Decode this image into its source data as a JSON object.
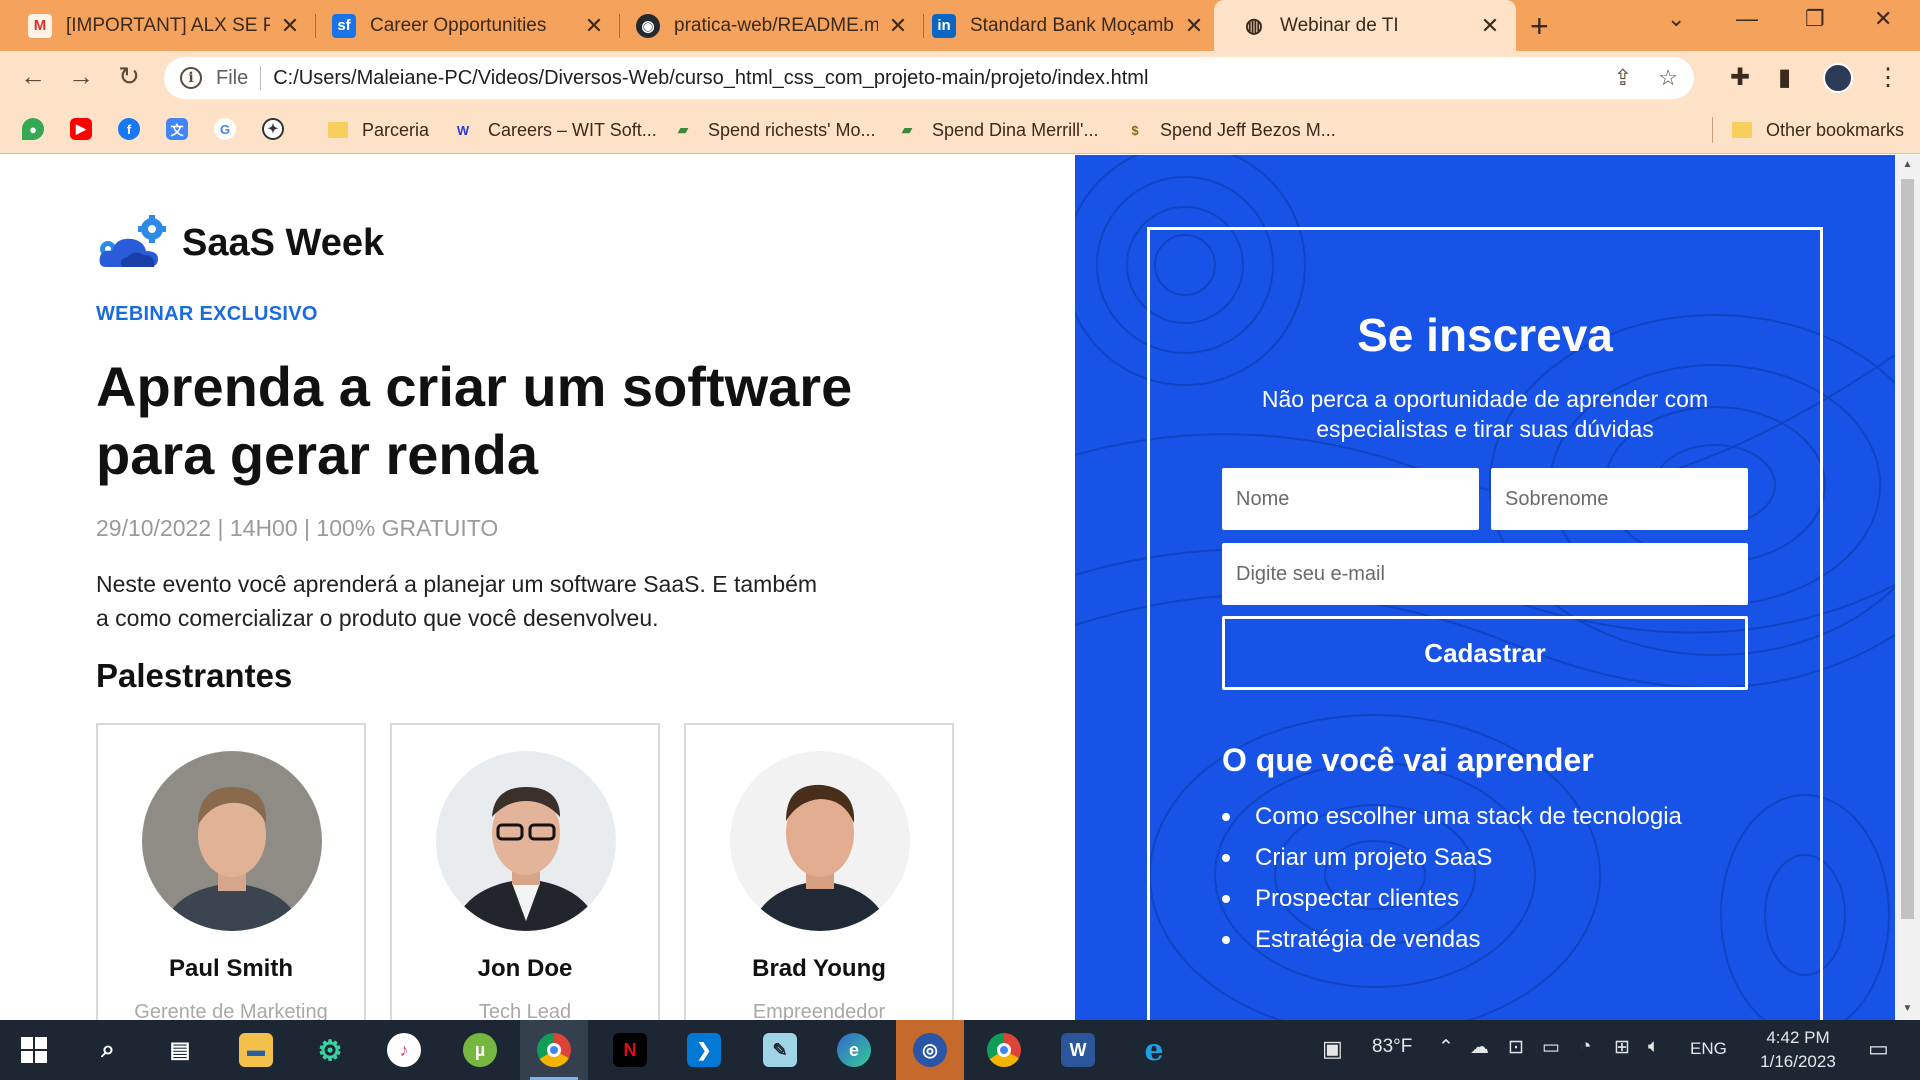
{
  "browser": {
    "tabs": [
      {
        "title": "[IMPORTANT] ALX SE Prog",
        "icon": "gmail-icon"
      },
      {
        "title": "Career Opportunities",
        "icon": "sf-icon"
      },
      {
        "title": "pratica-web/README.md",
        "icon": "github-icon"
      },
      {
        "title": "Standard Bank Moçambiq",
        "icon": "linkedin-icon"
      },
      {
        "title": "Webinar de TI",
        "icon": "globe-icon",
        "active": true
      }
    ],
    "new_tab": "+",
    "window_controls": {
      "tab_search": "⌄",
      "minimize": "—",
      "restore": "❐",
      "close": "✕"
    },
    "address_scheme": "File",
    "address_url": "C:/Users/Maleiane-PC/Videos/Diversos-Web/curso_html_css_com_projeto-main/projeto/index.html"
  },
  "bookmarks": {
    "icon_shortcuts": [
      "maps-icon",
      "youtube-icon",
      "facebook-icon",
      "translate-icon",
      "google-icon",
      "emblem-icon"
    ],
    "items": [
      {
        "label": "Parceria",
        "icon": "folder-icon"
      },
      {
        "label": "Careers – WIT Soft...",
        "icon": "wit-icon"
      },
      {
        "label": "Spend richests' Mo...",
        "icon": "money-icon"
      },
      {
        "label": "Spend Dina Merrill'...",
        "icon": "money-icon"
      },
      {
        "label": "Spend Jeff Bezos M...",
        "icon": "dollar-icon"
      }
    ],
    "other": "Other bookmarks"
  },
  "page": {
    "logo_text": "SaaS Week",
    "eyebrow": "WEBINAR EXCLUSIVO",
    "headline_line1": "Aprenda a criar um software",
    "headline_line2": "para gerar renda",
    "meta": "29/10/2022 | 14H00 | 100% GRATUITO",
    "description_line1": "Neste evento você aprenderá a planejar um software SaaS. E também",
    "description_line2": "a como comercializar o produto que você desenvolveu.",
    "speakers_title": "Palestrantes",
    "speakers": [
      {
        "name": "Paul Smith",
        "role": "Gerente de Marketing"
      },
      {
        "name": "Jon Doe",
        "role": "Tech Lead"
      },
      {
        "name": "Brad Young",
        "role": "Empreendedor"
      }
    ]
  },
  "form": {
    "title": "Se inscreva",
    "subtitle_line1": "Não perca a oportunidade de aprender com",
    "subtitle_line2": "especialistas e tirar suas dúvidas",
    "first_name_placeholder": "Nome",
    "last_name_placeholder": "Sobrenome",
    "email_placeholder": "Digite seu e-mail",
    "submit_label": "Cadastrar",
    "learn_title": "O que você vai aprender",
    "learn_items": [
      "Como escolher uma stack de tecnologia",
      "Criar um projeto SaaS",
      "Prospectar clientes",
      "Estratégia de vendas"
    ]
  },
  "taskbar": {
    "apps": [
      "start-icon",
      "search-icon",
      "task-view-icon",
      "file-explorer-icon",
      "settings-app-icon",
      "itunes-icon",
      "utorrent-icon",
      "chrome-icon",
      "netflix-icon",
      "vscode-icon",
      "notepad-icon",
      "edge-icon",
      "app-icon",
      "chrome-profile-icon",
      "word-icon",
      "internet-explorer-icon"
    ],
    "weather": "83°F",
    "language": "ENG",
    "time": "4:42 PM",
    "date": "1/16/2023"
  },
  "colors": {
    "tab_strip": "#f5a25d",
    "toolbar": "#fde2c8",
    "form_panel": "#1653e6",
    "eyebrow": "#1a6be0",
    "taskbar": "#1d2733"
  }
}
